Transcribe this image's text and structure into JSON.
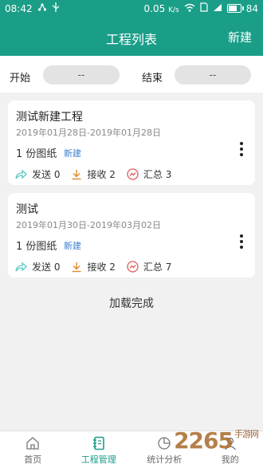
{
  "status_bar": {
    "time": "08:42",
    "net_speed": "0.05",
    "net_unit": "K/s",
    "battery": "84"
  },
  "header": {
    "title": "工程列表",
    "new_button": "新建"
  },
  "filter": {
    "start_label": "开始",
    "start_value": "--",
    "end_label": "结束",
    "end_value": "--"
  },
  "projects": [
    {
      "name": "测试新建工程",
      "dates": "2019年01月28日-2019年01月28日",
      "drawings": "1 份图纸",
      "tag": "新建",
      "send": "发送 0",
      "receive": "接收 2",
      "summary": "汇总 3"
    },
    {
      "name": "测试",
      "dates": "2019年01月30日-2019年03月02日",
      "drawings": "1 份图纸",
      "tag": "新建",
      "send": "发送 0",
      "receive": "接收 2",
      "summary": "汇总 7"
    }
  ],
  "load_status": "加载完成",
  "tabs": [
    {
      "label": "首页"
    },
    {
      "label": "工程管理"
    },
    {
      "label": "统计分析"
    },
    {
      "label": "我的"
    }
  ],
  "watermark": {
    "text": "2265",
    "suffix": "手游网"
  },
  "colors": {
    "primary": "#1a9e88",
    "tag_blue": "#3a7fd2"
  }
}
